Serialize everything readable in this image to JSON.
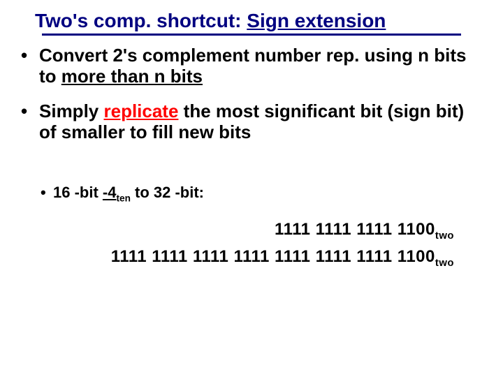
{
  "title": {
    "prefix": "Two's comp. shortcut: ",
    "underlined": "Sign extension"
  },
  "bullets": [
    {
      "pre": "Convert 2's complement number rep. using n bits to ",
      "underlined": "more than n bits",
      "post": ""
    },
    {
      "pre": "Simply ",
      "underlined_red": "replicate",
      "post": " the most significant bit (sign bit) of smaller to fill new bits"
    }
  ],
  "example": {
    "label_pre": "16 -bit ",
    "value_label": "-4",
    "value_sub": "ten",
    "label_post": " to 32 -bit:"
  },
  "binary": {
    "line16": "1111 1111 1111 1100",
    "line32": "1111 1111 1111 1111 1111 1111 1111 1100",
    "subscript": "two"
  }
}
